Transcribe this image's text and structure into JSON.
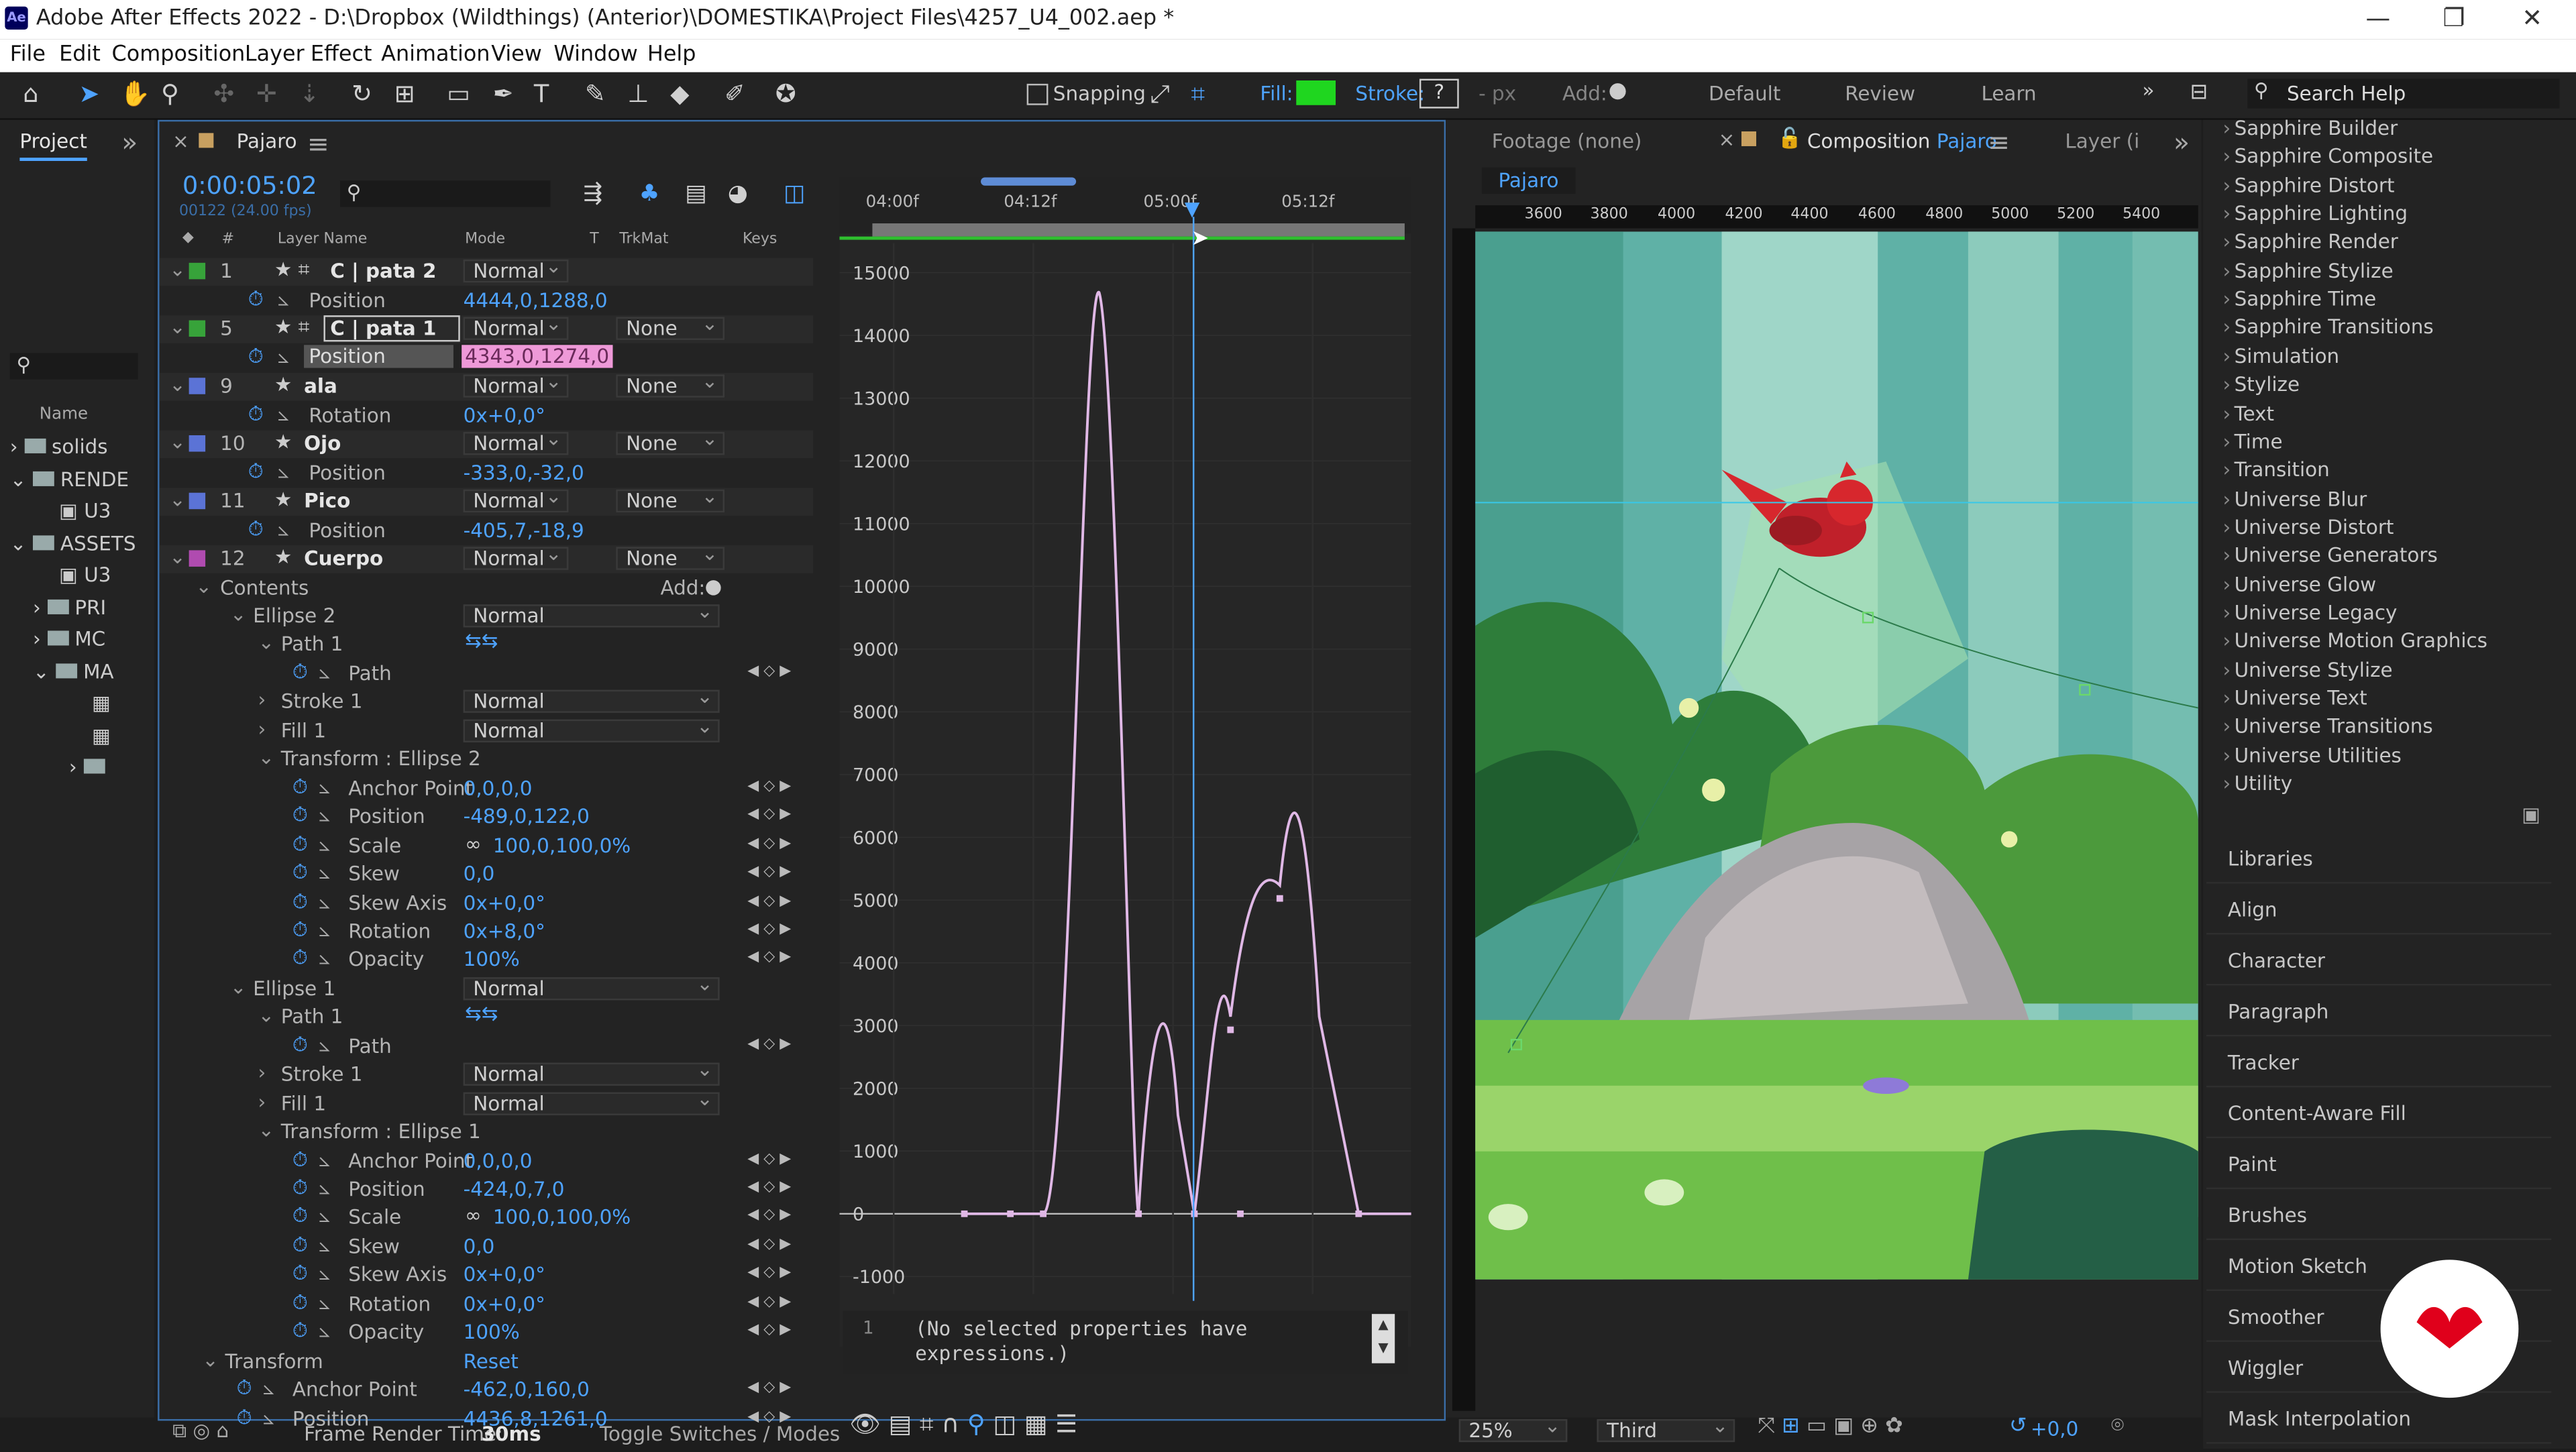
{
  "window": {
    "app_icon": "Ae",
    "title": "Adobe After Effects 2022 - D:\\Dropbox (Wildthings) (Anterior)\\DOMESTIKA\\Project Files\\4257_U4_002.aep *",
    "controls": [
      "minimize-icon",
      "restore-icon",
      "close-icon"
    ]
  },
  "menu": [
    "File",
    "Edit",
    "Composition",
    "Layer",
    "Effect",
    "Animation",
    "View",
    "Window",
    "Help"
  ],
  "toolbar": {
    "snapping": "Snapping",
    "fill_label": "Fill:",
    "fill_color": "#1fd61f",
    "stroke_label": "Stroke:",
    "stroke_value": "?",
    "px_label": "- px",
    "add_label": "Add:",
    "workspaces": [
      "Default",
      "Review",
      "Learn"
    ],
    "search_placeholder": "Search Help"
  },
  "project": {
    "tab": "Project",
    "col_name": "Name",
    "items": [
      "solids",
      "RENDE",
      "U3",
      "ASSETS",
      "U3",
      "PRI",
      "MC",
      "MA"
    ]
  },
  "timeline": {
    "tab": "Pajaro",
    "timecode": "0:00:05:02",
    "frames": "00122 (24.00 fps)",
    "cols": {
      "layer_name": "Layer Name",
      "mode": "Mode",
      "t": "T",
      "trkmat": "TrkMat",
      "keys": "Keys"
    },
    "ruler": [
      "04:00f",
      "04:12f",
      "05:00f",
      "05:12f"
    ],
    "rows": [
      {
        "num": "1",
        "name": "C | pata 2",
        "mode": "Normal",
        "color": "#37a33a",
        "layer": true
      },
      {
        "prop": "Position",
        "value": "4444,0,1288,0"
      },
      {
        "num": "5",
        "name": "C | pata 1",
        "mode": "Normal",
        "trk": "None",
        "color": "#37a33a",
        "layer": true
      },
      {
        "prop": "Position",
        "value": "4343,0,1274,0",
        "selected": true
      },
      {
        "num": "9",
        "name": "ala",
        "mode": "Normal",
        "trk": "None",
        "color": "#5b73d6",
        "layer": true
      },
      {
        "prop": "Rotation",
        "value": "0x+0,0°"
      },
      {
        "num": "10",
        "name": "Ojo",
        "mode": "Normal",
        "trk": "None",
        "color": "#5b73d6",
        "layer": true
      },
      {
        "prop": "Position",
        "value": "-333,0,-32,0"
      },
      {
        "num": "11",
        "name": "Pico",
        "mode": "Normal",
        "trk": "None",
        "color": "#5b73d6",
        "layer": true
      },
      {
        "prop": "Position",
        "value": "-405,7,-18,9"
      },
      {
        "num": "12",
        "name": "Cuerpo",
        "mode": "Normal",
        "trk": "None",
        "color": "#b04bb0",
        "layer": true
      }
    ],
    "contents": "Contents",
    "add": "Add:",
    "tree": [
      {
        "t": "Ellipse 2",
        "mode": "Normal",
        "ind": 1
      },
      {
        "t": "Path 1",
        "ind": 2,
        "icons": true
      },
      {
        "t": "Path",
        "ind": 3,
        "prop": true
      },
      {
        "t": "Stroke 1",
        "mode": "Normal",
        "ind": 2
      },
      {
        "t": "Fill 1",
        "mode": "Normal",
        "ind": 2
      },
      {
        "t": "Transform : Ellipse 2",
        "ind": 2
      },
      {
        "t": "Anchor Point",
        "value": "0,0,0,0",
        "ind": 3
      },
      {
        "t": "Position",
        "value": "-489,0,122,0",
        "ind": 3
      },
      {
        "t": "Scale",
        "value": "100,0,100,0%",
        "ind": 3
      },
      {
        "t": "Skew",
        "value": "0,0",
        "ind": 3
      },
      {
        "t": "Skew Axis",
        "value": "0x+0,0°",
        "ind": 3
      },
      {
        "t": "Rotation",
        "value": "0x+8,0°",
        "ind": 3
      },
      {
        "t": "Opacity",
        "value": "100%",
        "ind": 3
      },
      {
        "t": "Ellipse 1",
        "mode": "Normal",
        "ind": 1
      },
      {
        "t": "Path 1",
        "ind": 2,
        "icons": true
      },
      {
        "t": "Path",
        "ind": 3,
        "prop": true
      },
      {
        "t": "Stroke 1",
        "mode": "Normal",
        "ind": 2
      },
      {
        "t": "Fill 1",
        "mode": "Normal",
        "ind": 2
      },
      {
        "t": "Transform : Ellipse 1",
        "ind": 2
      },
      {
        "t": "Anchor Point",
        "value": "0,0,0,0",
        "ind": 3
      },
      {
        "t": "Position",
        "value": "-424,0,7,0",
        "ind": 3
      },
      {
        "t": "Scale",
        "value": "100,0,100,0%",
        "ind": 3
      },
      {
        "t": "Skew",
        "value": "0,0",
        "ind": 3
      },
      {
        "t": "Skew Axis",
        "value": "0x+0,0°",
        "ind": 3
      },
      {
        "t": "Rotation",
        "value": "0x+0,0°",
        "ind": 3
      },
      {
        "t": "Opacity",
        "value": "100%",
        "ind": 3
      },
      {
        "t": "Transform",
        "ind": 0,
        "value": "Reset"
      },
      {
        "t": "Anchor Point",
        "value": "-462,0,160,0",
        "ind": 1
      },
      {
        "t": "Position",
        "value": "4436,8,1261,0",
        "ind": 1
      }
    ],
    "frame_render_label": "Frame Render Time:",
    "frame_render_value": "30ms",
    "toggle": "Toggle Switches / Modes",
    "expression_line": "1",
    "expression_text": "(No selected properties have expressions.)"
  },
  "graph": {
    "y_labels": [
      "15000",
      "14000",
      "13000",
      "12000",
      "11000",
      "10000",
      "9000",
      "8000",
      "7000",
      "6000",
      "5000",
      "4000",
      "3000",
      "2000",
      "1000",
      "0",
      "-1000"
    ]
  },
  "viewer": {
    "footage_tab": "Footage (none)",
    "comp_tab_prefix": "Composition",
    "comp_tab_name": "Pajaro",
    "layer_tab": "Layer (i",
    "comp_name_tab": "Pajaro",
    "ruler": [
      "3600",
      "3800",
      "4000",
      "4200",
      "4400",
      "4600",
      "4800",
      "5000",
      "5200",
      "5400"
    ],
    "zoom": "25%",
    "resolution": "Third",
    "exposure": "+0,0"
  },
  "effects": [
    "Sapphire Builder",
    "Sapphire Composite",
    "Sapphire Distort",
    "Sapphire Lighting",
    "Sapphire Render",
    "Sapphire Stylize",
    "Sapphire Time",
    "Sapphire Transitions",
    "Simulation",
    "Stylize",
    "Text",
    "Time",
    "Transition",
    "Universe Blur",
    "Universe Distort",
    "Universe Generators",
    "Universe Glow",
    "Universe Legacy",
    "Universe Motion Graphics",
    "Universe Stylize",
    "Universe Text",
    "Universe Transitions",
    "Universe Utilities",
    "Utility"
  ],
  "panels": [
    "Libraries",
    "Align",
    "Character",
    "Paragraph",
    "Tracker",
    "Content-Aware Fill",
    "Paint",
    "Brushes",
    "Motion Sketch",
    "Smoother",
    "Wiggler",
    "Mask Interpolation"
  ],
  "colors": {
    "accent": "#4ea3ff",
    "graph_curve": "#e0b8e6",
    "brand_badge": "#e0001b"
  }
}
